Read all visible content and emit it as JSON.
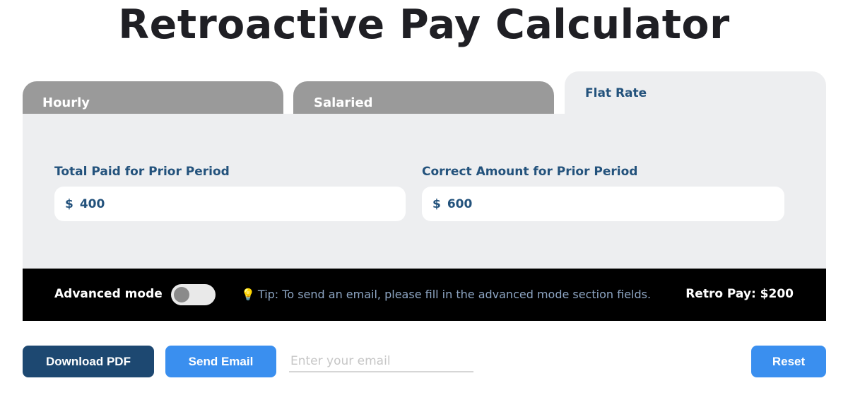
{
  "page": {
    "title": "Retroactive Pay Calculator"
  },
  "tabs": [
    {
      "label": "Hourly",
      "active": false
    },
    {
      "label": "Salaried",
      "active": false
    },
    {
      "label": "Flat Rate",
      "active": true
    }
  ],
  "form": {
    "total_paid": {
      "label": "Total Paid for Prior Period",
      "currency": "$",
      "value": "400"
    },
    "correct_amount": {
      "label": "Correct Amount for Prior Period",
      "currency": "$",
      "value": "600"
    }
  },
  "footer_bar": {
    "advanced_mode_label": "Advanced mode",
    "advanced_mode_on": false,
    "tip_icon": "lightbulb-icon",
    "tip_text": "Tip: To send an email, please fill in the advanced mode section fields.",
    "retro_pay": "Retro Pay: $200"
  },
  "actions": {
    "download_pdf": "Download PDF",
    "send_email": "Send Email",
    "email_placeholder": "Enter your email",
    "reset": "Reset"
  },
  "colors": {
    "accent_blue": "#3a8fef",
    "navy": "#1d4871",
    "label_blue": "#23527c",
    "tab_inactive": "#9a9a9a",
    "panel_bg": "#edeef0"
  }
}
